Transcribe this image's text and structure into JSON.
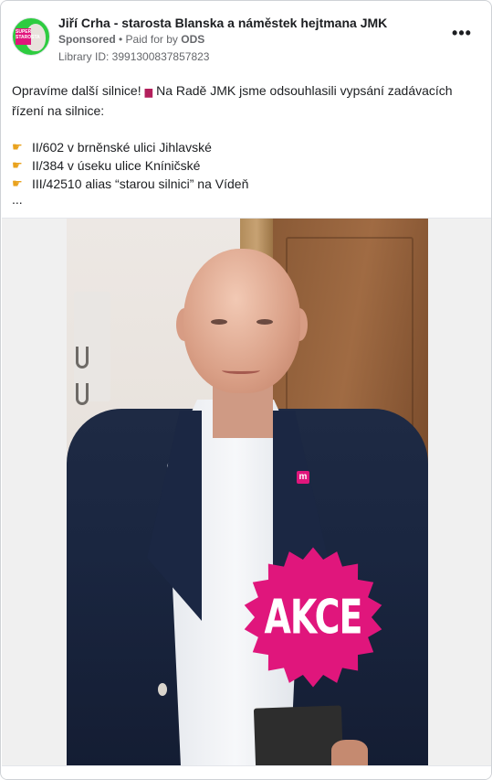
{
  "post": {
    "page_name": "Jiří Crha - starosta Blanska a náměstek hejtmana JMK",
    "sponsored_label": "Sponsored",
    "separator": " • ",
    "paid_for_prefix": "Paid for by ",
    "paid_for_by": "ODS",
    "library_id": "Library ID: 3991300837857823",
    "more_icon": "more-horizontal-icon",
    "more_label": "•••"
  },
  "avatar": {
    "badge_text": "SUPER STAROSTA"
  },
  "text": {
    "line1": "Opravíme další silnice!",
    "line1b": "Na Radě JMK jsme odsouhlasili vypsání zadávacích řízení na silnice:",
    "car_icon": "car-icon",
    "items": [
      "II/602 v brněnské ulici Jihlavské",
      "II/384 v úseku ulice Kníničské",
      "III/42510 alias “starou silnici” na Vídeň"
    ],
    "pointer_icon": "pointing-hand-icon",
    "ellipsis": "..."
  },
  "image": {
    "badge_text": "AKCE",
    "pin_text": "m",
    "badge_color": "#e0167c"
  }
}
